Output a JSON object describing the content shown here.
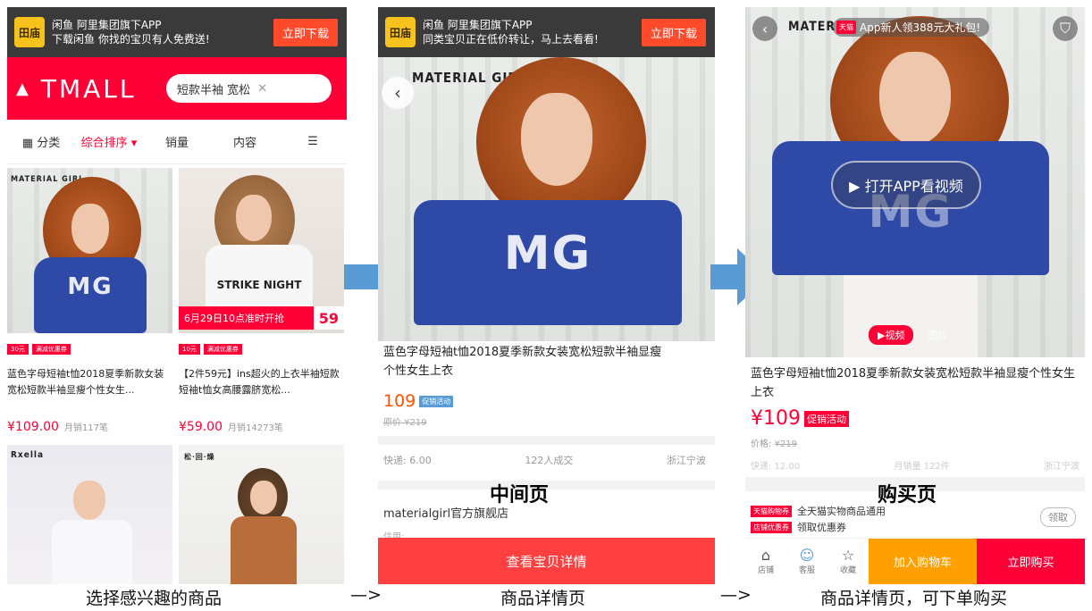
{
  "banner": {
    "logo": "田庙",
    "line1": "闲鱼 阿里集团旗下APP",
    "left_line2": "下载闲鱼 你找的宝贝有人免费送!",
    "mid_line2": "同类宝贝正在低价转让，马上去看看!",
    "download": "立即下载"
  },
  "left": {
    "brand": "TMALL",
    "search_query": "短款半袖 宽松",
    "sort": [
      "分类",
      "综合排序 ▾",
      "销量",
      "内容"
    ],
    "cards": [
      {
        "brandmark": "MATERIAL GIRL",
        "tags": [
          "30元",
          "满减优惠券"
        ],
        "title": "蓝色字母短袖t恤2018夏季新款女装宽松短款半袖显瘦个性女生...",
        "price": "¥109.00",
        "sales": "月销117笔"
      },
      {
        "brandmark": "",
        "tags": [
          "10元",
          "满减优惠券"
        ],
        "title": "【2件59元】ins超火的上衣半袖短款短袖t恤女高腰露脐宽松...",
        "price": "¥59.00",
        "sales": "月销14273笔",
        "promo": "6月29日10点准时开抢",
        "promo_price": "59",
        "shirt_text": "STRIKE NIGHT"
      },
      {
        "brandmark": "Rxella"
      },
      {
        "brandmark": "松·回·燥"
      }
    ]
  },
  "mid": {
    "brandmark": "MATERIAL GIRL",
    "title": "蓝色字母短袖t恤2018夏季新款女装宽松短款半袖显瘦个性女生上衣",
    "price": "109",
    "promo": "促销活动",
    "orig_price": "原价 ¥219",
    "ship": "快递: 6.00",
    "deals": "122人成交",
    "location": "浙江宁波",
    "shop": "materialgirl官方旗舰店",
    "credit": "信用:",
    "detail_btn": "查看宝贝详情"
  },
  "right": {
    "brandmark": "MATERI",
    "tip_badge": "天猫",
    "tip": "App新人领388元大礼包!",
    "video_pill": "▶ 打开APP看视频",
    "tab_video": "▶视频",
    "tab_photo": "图片",
    "title": "蓝色字母短袖t恤2018夏季新款女装宽松短款半袖显瘦个性女生上衣",
    "price": "¥109",
    "promo": "促销活动",
    "ref_label": "价格:",
    "ref_price": "¥219",
    "ship": "快递: 12.00",
    "sales": "月销量 122件",
    "location": "浙江宁波",
    "coupon1_badge": "天猫购物券",
    "coupon1": "全天猫实物商品通用",
    "coupon2_badge": "店铺优惠券",
    "coupon2": "领取优惠券",
    "claim": "领取",
    "bar": {
      "store": "店铺",
      "service": "客服",
      "fav": "收藏",
      "cart": "加入购物车",
      "buy": "立即购买"
    }
  },
  "labels": {
    "mid_page": "中间页",
    "buy_page": "购买页"
  },
  "captions": {
    "left": "选择感兴趣的商品",
    "arrow1": "—>",
    "mid": "商品详情页",
    "arrow2": "—>",
    "right": "商品详情页，可下单购买"
  },
  "colors": {
    "tmall_red": "#ff0036",
    "arrow_blue": "#5b9bd5",
    "banner": "#3a3a3a"
  }
}
